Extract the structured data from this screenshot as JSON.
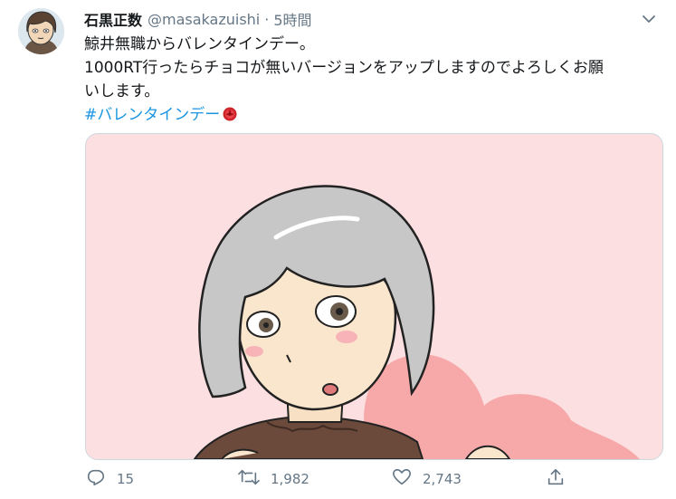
{
  "tweet": {
    "author_name": "石黒正数",
    "handle": "@masakazuishi",
    "separator": "·",
    "time": "5時間",
    "text_lines": [
      "鯨井無職からバレンタインデー。",
      "1000RT行ったらチョコが無いバージョンをアップしますのでよろしくお願",
      "いします。"
    ],
    "hashtag": "#バレンタインデー",
    "emoji_icon": "rose-icon"
  },
  "actions": {
    "reply_count": "15",
    "retweet_count": "1,982",
    "like_count": "2,743"
  },
  "colors": {
    "text": "#14171a",
    "secondary": "#657786",
    "link": "#1b95e0",
    "media_bg": "#fcdfe0",
    "heart": "#f7a9aa"
  }
}
